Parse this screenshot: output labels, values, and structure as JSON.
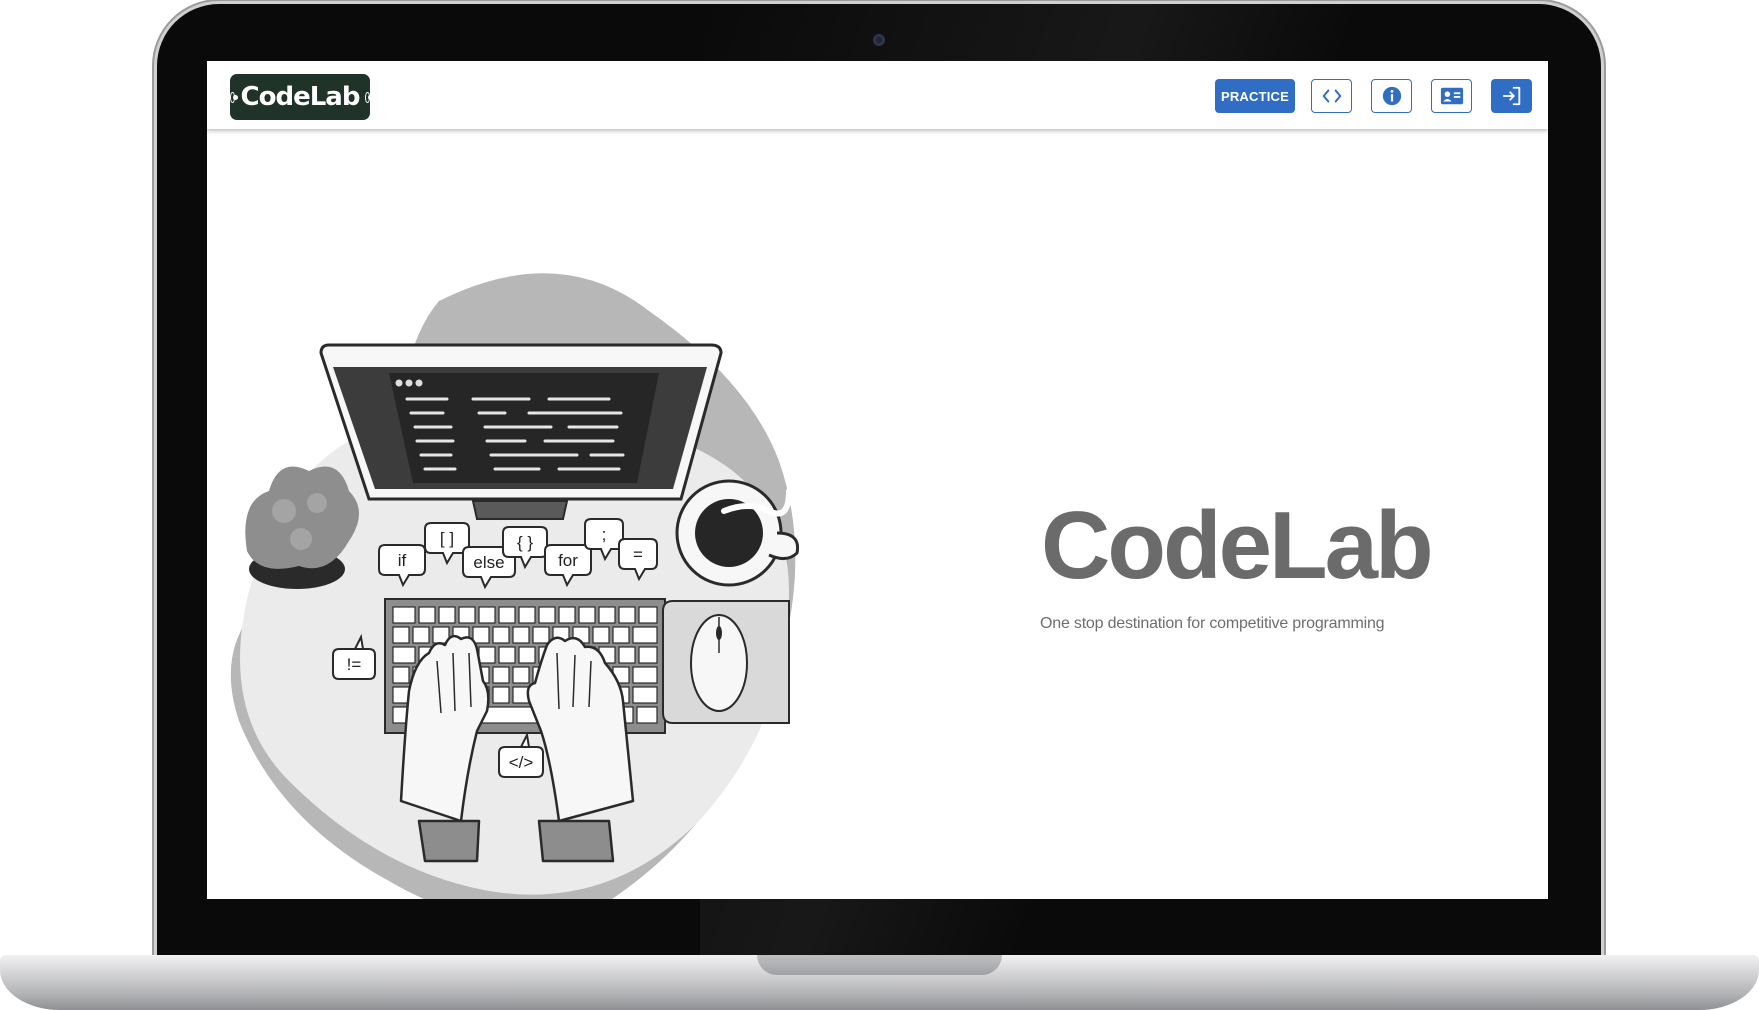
{
  "app": {
    "logo_text": "CodeLab"
  },
  "navbar": {
    "practice_label": "PRACTICE",
    "buttons": [
      {
        "icon": "code-icon",
        "style": "outline"
      },
      {
        "icon": "info-icon",
        "style": "outline"
      },
      {
        "icon": "contact-card-icon",
        "style": "outline"
      },
      {
        "icon": "login-icon",
        "style": "solid"
      }
    ],
    "accent_color": "#2f6ec4"
  },
  "hero": {
    "title": "CodeLab",
    "subtitle": "One stop destination for competitive programming",
    "illustration": {
      "keyword_bubbles": [
        "if",
        "[ ]",
        "else",
        "{ }",
        "for",
        ";",
        "=",
        "!=",
        "</>"
      ]
    }
  }
}
